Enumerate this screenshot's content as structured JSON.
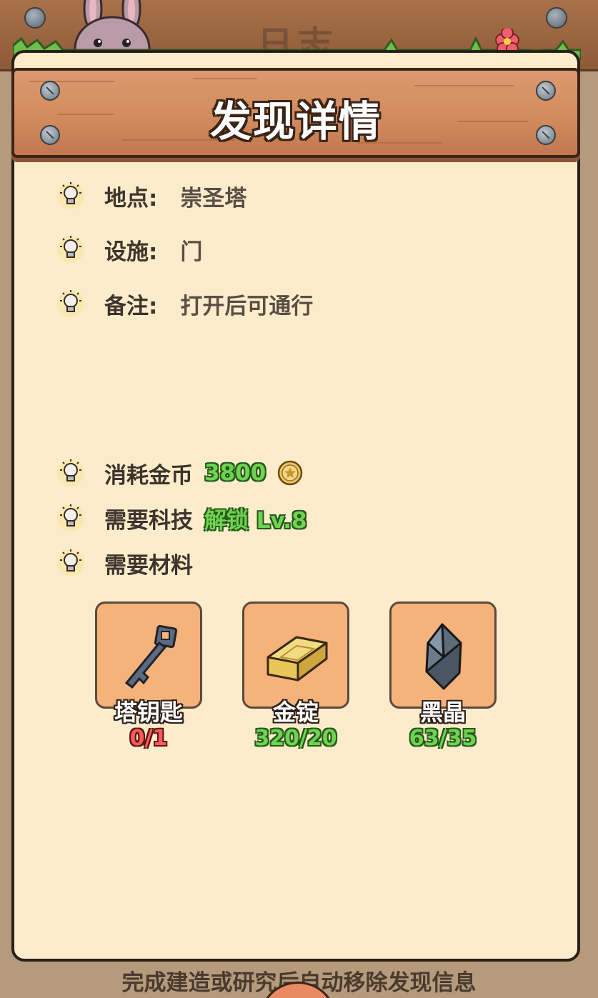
{
  "background": {
    "title": "日志"
  },
  "header": {
    "title": "发现详情"
  },
  "info": {
    "location_label": "地点:",
    "location_value": "崇圣塔",
    "facility_label": "设施:",
    "facility_value": "门",
    "note_label": "备注:",
    "note_value": "打开后可通行"
  },
  "cost": {
    "coin_label": "消耗金币",
    "coin_value": "3800",
    "tech_label": "需要科技",
    "tech_value": "解锁 Lv.8",
    "materials_label": "需要材料"
  },
  "materials": [
    {
      "name": "塔钥匙",
      "count": "0/1",
      "status": "insufficient",
      "icon": "key-icon"
    },
    {
      "name": "金锭",
      "count": "320/20",
      "status": "sufficient",
      "icon": "gold-ingot-icon"
    },
    {
      "name": "黑晶",
      "count": "63/35",
      "status": "sufficient",
      "icon": "black-crystal-icon"
    }
  ],
  "footer": {
    "hint": "完成建造或研究后自动移除发现信息"
  },
  "colors": {
    "panel": "#fdeccb",
    "header_wood": "#d08a5d",
    "green": "#6fd253",
    "red": "#ff5a58",
    "material_bg": "#f5b27a"
  }
}
